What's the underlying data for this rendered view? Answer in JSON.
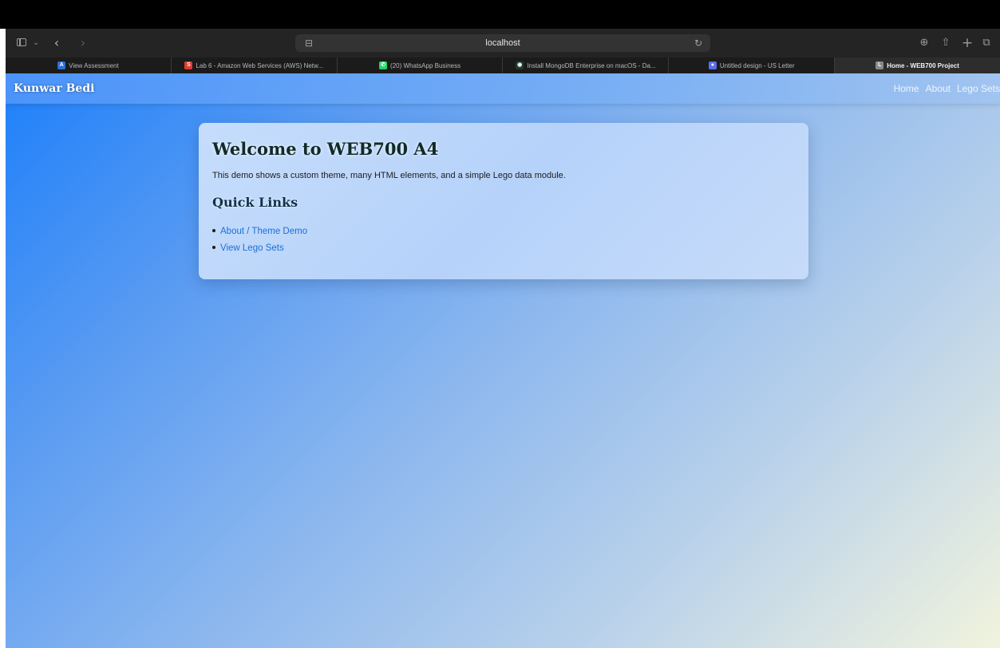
{
  "browser": {
    "address_url": "localhost",
    "icons": {
      "sidebar": "sidebar-icon",
      "back": "chevron-left-icon",
      "forward": "chevron-right-icon",
      "reload": "reload-icon",
      "download": "download-icon",
      "share": "share-icon",
      "new_tab": "plus-icon",
      "tab_overview": "tabs-overview-icon"
    },
    "tabs": [
      {
        "label": "View Assessment",
        "favicon_color": "#2b6fd6",
        "favicon_glyph": "A",
        "active": false
      },
      {
        "label": "Lab 6 - Amazon Web Services (AWS) Netw...",
        "favicon_color": "#e23a2c",
        "favicon_glyph": "S",
        "active": false
      },
      {
        "label": "(20) WhatsApp Business",
        "favicon_color": "#25d366",
        "favicon_glyph": "✆",
        "active": false
      },
      {
        "label": "Install MongoDB Enterprise on macOS - Da...",
        "favicon_color": "#1d3b2a",
        "favicon_glyph": "◉",
        "active": false
      },
      {
        "label": "Untitled design - US Letter",
        "favicon_color": "#5b6ee8",
        "favicon_glyph": "●",
        "active": false
      },
      {
        "label": "Home - WEB700 Project",
        "favicon_color": "#8a8a8a",
        "favicon_glyph": "L",
        "active": true
      }
    ]
  },
  "site": {
    "brand": "Kunwar Bedi",
    "nav": [
      "Home",
      "About",
      "Lego Sets"
    ]
  },
  "card": {
    "title": "Welcome to WEB700 A4",
    "description": "This demo shows a custom theme, many HTML elements, and a simple Lego data module.",
    "subtitle": "Quick Links",
    "links": [
      "About / Theme Demo",
      "View Lego Sets"
    ]
  },
  "colors": {
    "link": "#1a6fd8",
    "gradient_start": "#1e80fa",
    "gradient_end": "#f1f3dd"
  }
}
